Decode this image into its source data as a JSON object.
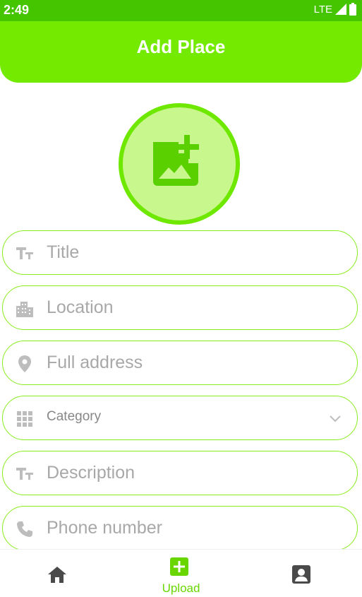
{
  "status_bar": {
    "time": "2:49",
    "network": "LTE"
  },
  "app_bar": {
    "title": "Add Place"
  },
  "photo_picker": {
    "icon": "add-photo-icon"
  },
  "form": {
    "title": {
      "placeholder": "Title",
      "value": "",
      "icon": "text-icon"
    },
    "location": {
      "placeholder": "Location",
      "value": "",
      "icon": "city-icon"
    },
    "address": {
      "placeholder": "Full address",
      "value": "",
      "icon": "pin-icon"
    },
    "category": {
      "selected": "Category",
      "icon": "grid-icon"
    },
    "description": {
      "placeholder": "Description",
      "value": "",
      "icon": "text-icon"
    },
    "phone": {
      "placeholder": "Phone number",
      "value": "",
      "icon": "phone-icon"
    }
  },
  "bottom_nav": {
    "items": [
      {
        "label": "",
        "icon": "home-icon"
      },
      {
        "label": "Upload",
        "icon": "add-box-icon",
        "active": true
      },
      {
        "label": "",
        "icon": "account-box-icon"
      }
    ]
  },
  "colors": {
    "status_bar": "#45c400",
    "app_bar": "#74ea00",
    "accent": "#6fe800",
    "picker_fill": "#c8f78d",
    "field_border": "#88ec1c",
    "icon_gray": "#bdbdbd"
  }
}
